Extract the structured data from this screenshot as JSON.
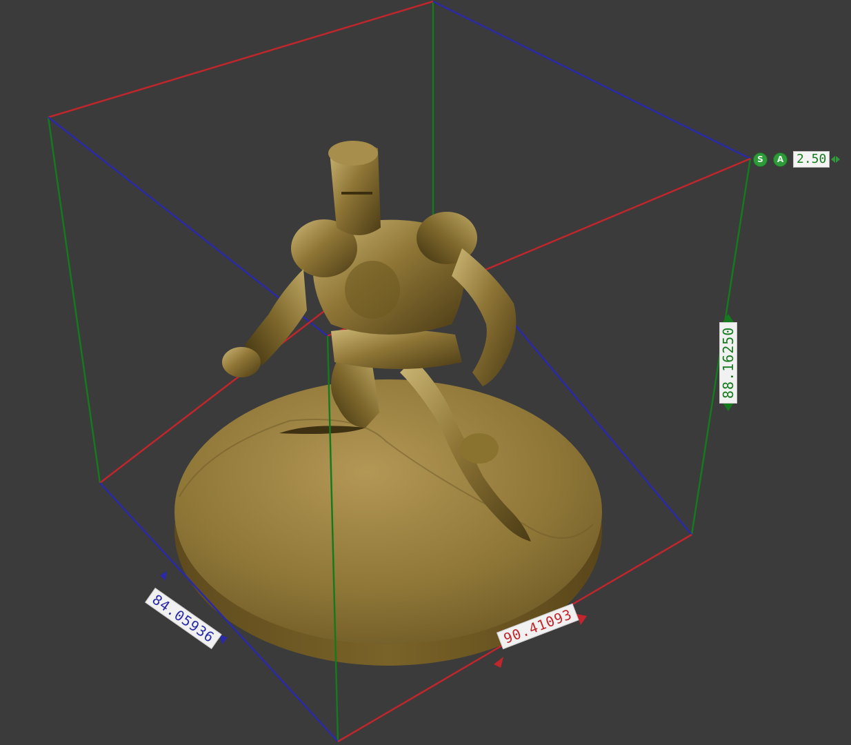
{
  "viewport": {
    "background": "#3b3b3b"
  },
  "bounding_box": {
    "axis_colors": {
      "x": "#c0262b",
      "y": "#2a2aa8",
      "z": "#157a1d"
    },
    "dimensions": {
      "x": "90.41093",
      "y": "84.05936",
      "z": "88.16250"
    }
  },
  "model": {
    "type": "knight-figurine",
    "material_color": "#9c8141"
  },
  "gizmo": {
    "s_button": "S",
    "a_button": "A",
    "value": "2.50"
  }
}
